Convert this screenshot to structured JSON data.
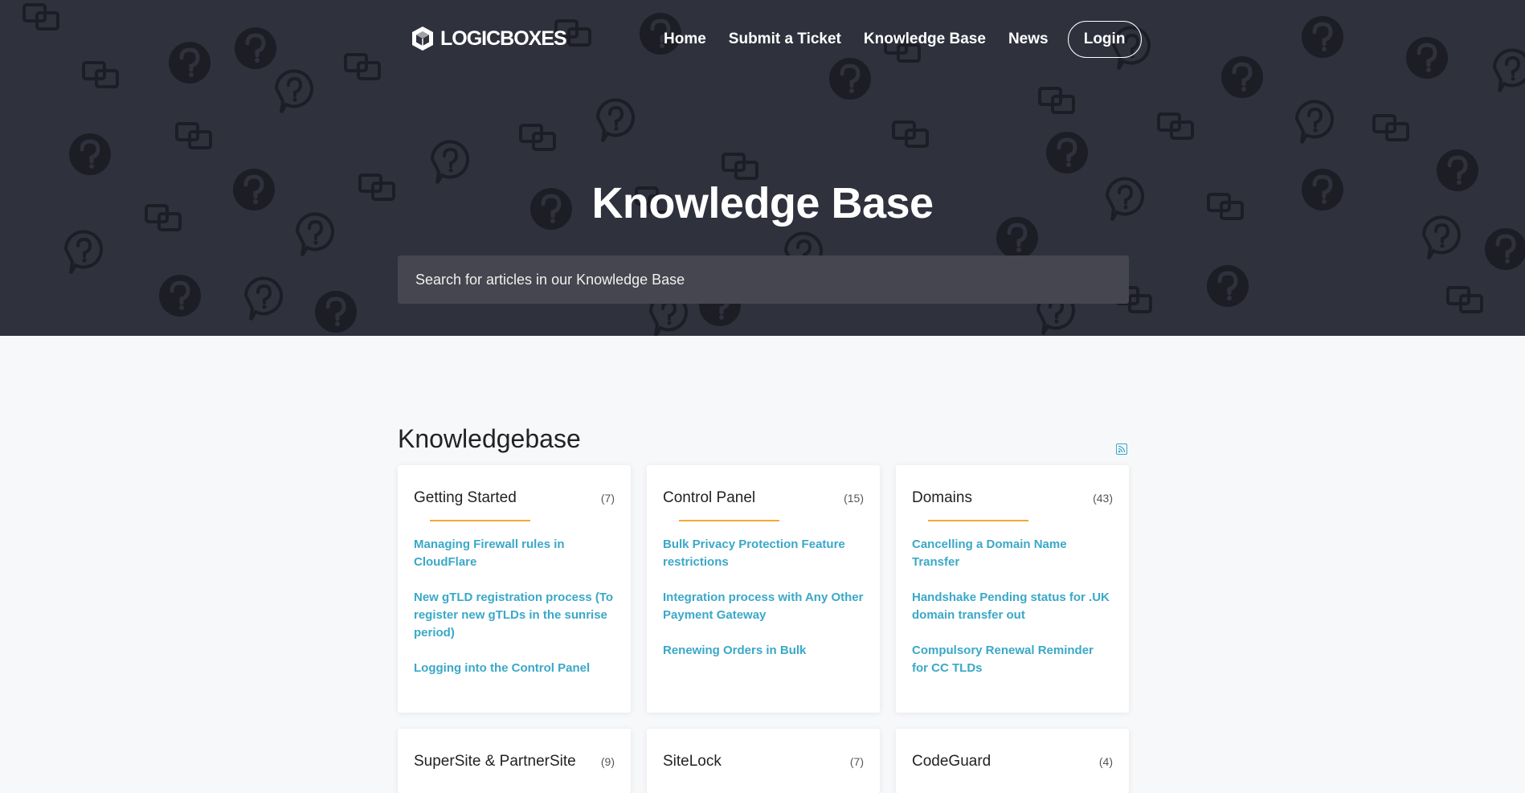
{
  "header": {
    "logo_text": "LOGICBOXES",
    "nav": [
      {
        "label": "Home"
      },
      {
        "label": "Submit a Ticket"
      },
      {
        "label": "Knowledge Base"
      },
      {
        "label": "News"
      }
    ],
    "login_label": "Login"
  },
  "hero": {
    "title": "Knowledge Base",
    "search_placeholder": "Search for articles in our Knowledge Base"
  },
  "section": {
    "title": "Knowledgebase",
    "rss_icon": "rss-icon"
  },
  "categories": [
    {
      "title": "Getting Started",
      "count": "(7)",
      "articles": [
        "Managing Firewall rules in CloudFlare",
        "New gTLD registration process (To register new gTLDs in the sunrise period)",
        "Logging into the Control Panel"
      ]
    },
    {
      "title": "Control Panel",
      "count": "(15)",
      "articles": [
        "Bulk Privacy Protection Feature restrictions",
        "Integration process with Any Other Payment Gateway",
        "Renewing Orders in Bulk"
      ]
    },
    {
      "title": "Domains",
      "count": "(43)",
      "articles": [
        "Cancelling a Domain Name Transfer",
        "Handshake Pending status for .UK domain transfer out",
        "Compulsory Renewal Reminder for CC TLDs"
      ]
    },
    {
      "title": "SuperSite & PartnerSite",
      "count": "(9)"
    },
    {
      "title": "SiteLock",
      "count": "(7)"
    },
    {
      "title": "CodeGuard",
      "count": "(4)"
    }
  ],
  "colors": {
    "hero_bg": "#2f313d",
    "link": "#3aa8c8",
    "accent": "#f2a833",
    "page_bg": "#f7f8fa"
  }
}
